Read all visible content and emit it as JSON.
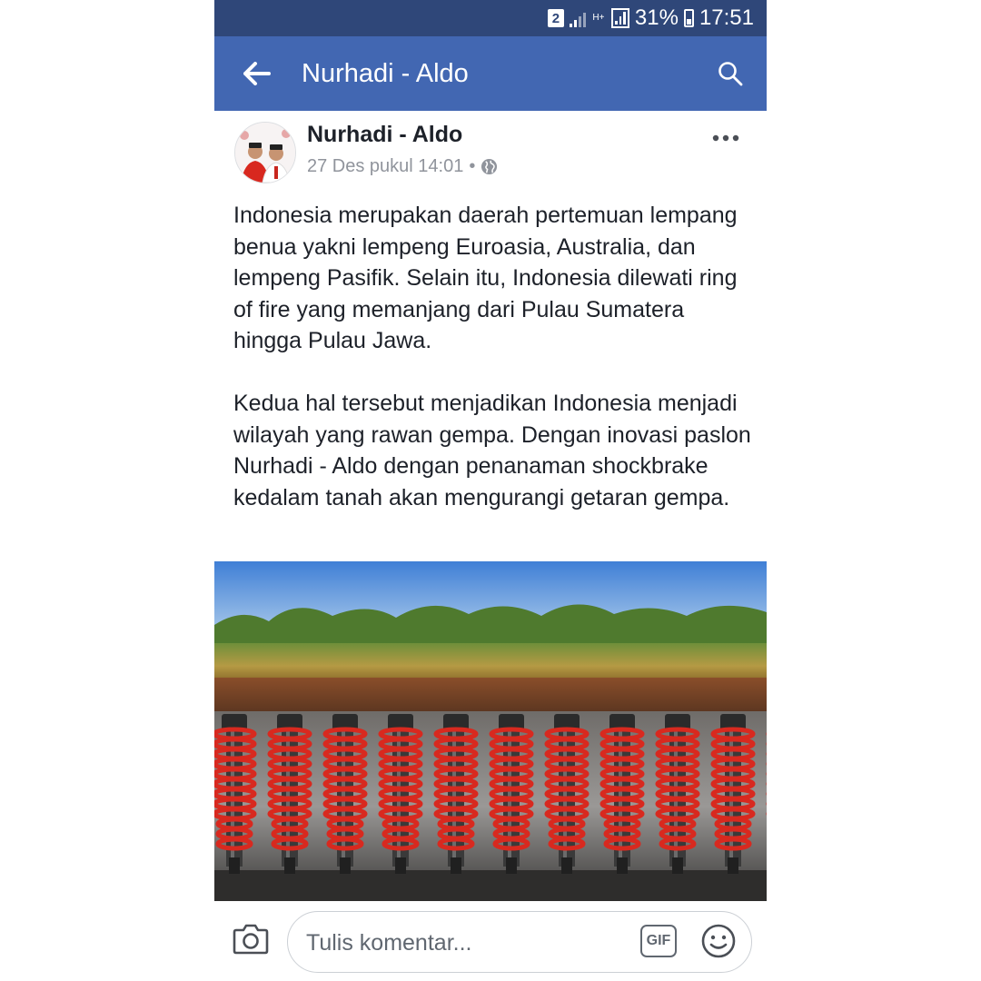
{
  "status_bar": {
    "sim": "2",
    "network": "H+",
    "battery": "31%",
    "time": "17:51"
  },
  "app_bar": {
    "title": "Nurhadi - Aldo"
  },
  "post": {
    "author": "Nurhadi - Aldo",
    "date": "27 Des pukul 14:01",
    "separator": "•",
    "paragraphs": [
      "Indonesia merupakan daerah pertemuan lempang benua yakni lempeng Euroasia, Australia, dan lempeng Pasifik. Selain itu, Indonesia dilewati ring of fire yang memanjang dari Pulau Sumatera hingga Pulau Jawa.",
      "Kedua hal tersebut menjadikan Indonesia menjadi wilayah yang rawan gempa. Dengan inovasi paslon Nurhadi - Aldo dengan penanaman shockbrake kedalam tanah akan mengurangi getaran gempa."
    ]
  },
  "comment_bar": {
    "placeholder": "Tulis komentar...",
    "gif_label": "GIF"
  },
  "colors": {
    "status_bar": "#2f4779",
    "app_bar": "#4267b2",
    "shock_spring": "#d8291f"
  },
  "icons": [
    "back-arrow-icon",
    "search-icon",
    "more-options-icon",
    "globe-icon",
    "camera-icon",
    "gif-icon",
    "emoji-icon"
  ]
}
